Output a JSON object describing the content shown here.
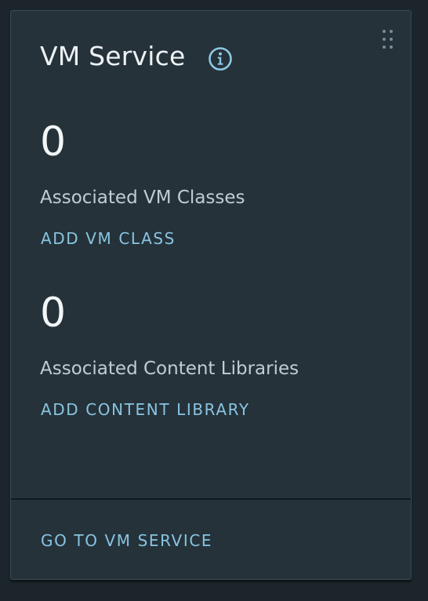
{
  "card": {
    "title": "VM Service",
    "icons": {
      "info": "info-icon",
      "drag_handle": "drag-handle-icon"
    },
    "metrics": [
      {
        "value": "0",
        "label": "Associated VM Classes",
        "action": "ADD VM CLASS"
      },
      {
        "value": "0",
        "label": "Associated Content Libraries",
        "action": "ADD CONTENT LIBRARY"
      }
    ],
    "footer_action": "GO TO VM SERVICE"
  },
  "colors": {
    "background": "#1c252c",
    "card": "#25323a",
    "link": "#89c4e0",
    "text": "#eef2f4",
    "muted_text": "#c3ccd1",
    "info_icon": "#8fc8e4"
  }
}
